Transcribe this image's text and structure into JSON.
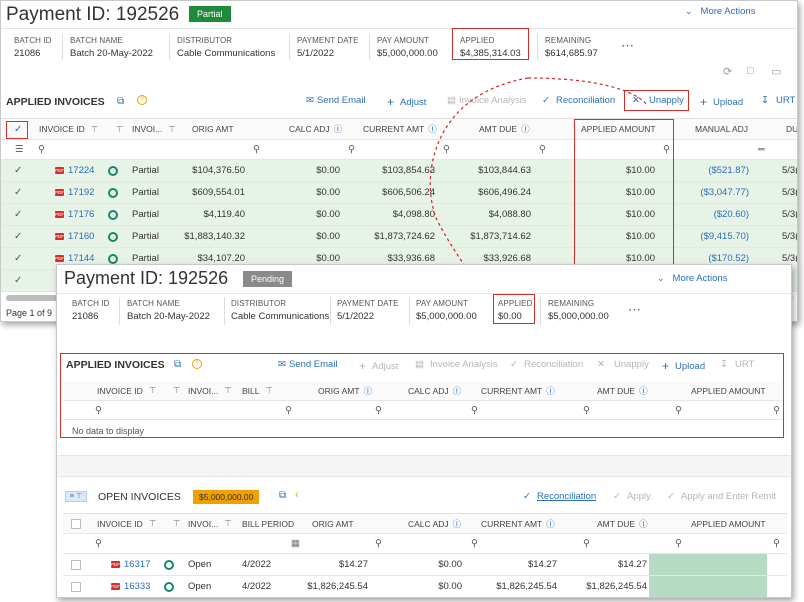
{
  "back": {
    "title": "Payment ID: 192526",
    "status": "Partial",
    "more_actions": "More Actions",
    "fields": [
      {
        "label": "BATCH ID",
        "value": "21086"
      },
      {
        "label": "BATCH NAME",
        "value": "Batch 20-May-2022"
      },
      {
        "label": "DISTRIBUTOR",
        "value": "Cable Communications"
      },
      {
        "label": "PAYMENT DATE",
        "value": "5/1/2022"
      },
      {
        "label": "PAY AMOUNT",
        "value": "$5,000,000.00"
      },
      {
        "label": "APPLIED",
        "value": "$4,385,314.03"
      },
      {
        "label": "REMAINING",
        "value": "$614,685.97"
      }
    ],
    "section_title": "APPLIED INVOICES",
    "toolbar": {
      "send_email": "Send Email",
      "adjust": "Adjust",
      "invoice_analysis": "Invoice Analysis",
      "reconciliation": "Reconciliation",
      "unapply": "Unapply",
      "upload": "Upload",
      "urt": "URT"
    },
    "columns": {
      "invoice_id": "INVOICE ID",
      "invoice_type": "INVOI...",
      "orig_amt": "ORIG AMT",
      "calc_adj": "CALC ADJ",
      "current_amt": "CURRENT AMT",
      "amt_due": "AMT DUE",
      "applied_amount": "APPLIED AMOUNT",
      "manual_adj": "MANUAL ADJ",
      "due": "DU"
    },
    "rows": [
      {
        "id": "17224",
        "type": "Partial",
        "orig": "$104,376.50",
        "calc": "$0.00",
        "current": "$103,854.63",
        "due": "$103,844.63",
        "applied": "$10.00",
        "manual": "($521.87)",
        "du": "5/3("
      },
      {
        "id": "17192",
        "type": "Partial",
        "orig": "$609,554.01",
        "calc": "$0.00",
        "current": "$606,506.24",
        "due": "$606,496.24",
        "applied": "$10.00",
        "manual": "($3,047.77)",
        "du": "5/3("
      },
      {
        "id": "17176",
        "type": "Partial",
        "orig": "$4,119.40",
        "calc": "$0.00",
        "current": "$4,098.80",
        "due": "$4,088.80",
        "applied": "$10.00",
        "manual": "($20.60)",
        "du": "5/3("
      },
      {
        "id": "17160",
        "type": "Partial",
        "orig": "$1,883,140.32",
        "calc": "$0.00",
        "current": "$1,873,724.62",
        "due": "$1,873,714.62",
        "applied": "$10.00",
        "manual": "($9,415.70)",
        "du": "5/3("
      },
      {
        "id": "17144",
        "type": "Partial",
        "orig": "$34,107.20",
        "calc": "$0.00",
        "current": "$33,936.68",
        "due": "$33,926.68",
        "applied": "$10.00",
        "manual": "($170.52)",
        "du": "5/3("
      }
    ],
    "pager": "Page 1 of 9"
  },
  "front": {
    "title": "Payment ID: 192526",
    "status": "Pending",
    "more_actions": "More Actions",
    "fields": [
      {
        "label": "BATCH ID",
        "value": "21086"
      },
      {
        "label": "BATCH NAME",
        "value": "Batch 20-May-2022"
      },
      {
        "label": "DISTRIBUTOR",
        "value": "Cable Communications"
      },
      {
        "label": "PAYMENT DATE",
        "value": "5/1/2022"
      },
      {
        "label": "PAY AMOUNT",
        "value": "$5,000,000.00"
      },
      {
        "label": "APPLIED",
        "value": "$0.00"
      },
      {
        "label": "REMAINING",
        "value": "$5,000,000.00"
      }
    ],
    "applied": {
      "title": "APPLIED INVOICES",
      "toolbar": {
        "send_email": "Send Email",
        "adjust": "Adjust",
        "invoice_analysis": "Invoice Analysis",
        "reconciliation": "Reconciliation",
        "unapply": "Unapply",
        "upload": "Upload",
        "urt": "URT"
      },
      "columns": {
        "invoice_id": "INVOICE ID",
        "invoice_type": "INVOI...",
        "bill": "BILL",
        "orig_amt": "ORIG AMT",
        "calc_adj": "CALC ADJ",
        "current_amt": "CURRENT AMT",
        "amt_due": "AMT DUE",
        "applied_amount": "APPLIED AMOUNT"
      },
      "empty": "No data to display"
    },
    "open": {
      "title": "OPEN INVOICES",
      "badge": "$5,000,000.00",
      "toolbar": {
        "reconciliation": "Reconciliation",
        "apply": "Apply",
        "apply_enter_remit": "Apply and Enter Remit"
      },
      "columns": {
        "invoice_id": "INVOICE ID",
        "invoice_type": "INVOI...",
        "bill_period": "BILL PERIOD",
        "orig_amt": "ORIG AMT",
        "calc_adj": "CALC ADJ",
        "current_amt": "CURRENT AMT",
        "amt_due": "AMT DUE",
        "applied_amount": "APPLIED AMOUNT"
      },
      "rows": [
        {
          "id": "16317",
          "type": "Open",
          "period": "4/2022",
          "orig": "$14.27",
          "calc": "$0.00",
          "current": "$14.27",
          "due": "$14.27"
        },
        {
          "id": "16333",
          "type": "Open",
          "period": "4/2022",
          "orig": "$1,826,245.54",
          "calc": "$0.00",
          "current": "$1,826,245.54",
          "due": "$1,826,245.54"
        }
      ]
    }
  },
  "colors": {
    "accent": "#2a6fb8",
    "partial": "#1e8a3c",
    "pending": "#8a8a8a",
    "highlight": "#d32f2f",
    "badge": "#f0a000",
    "applied_row": "#e7f3e7",
    "applied_cell": "#b5dcc3"
  }
}
